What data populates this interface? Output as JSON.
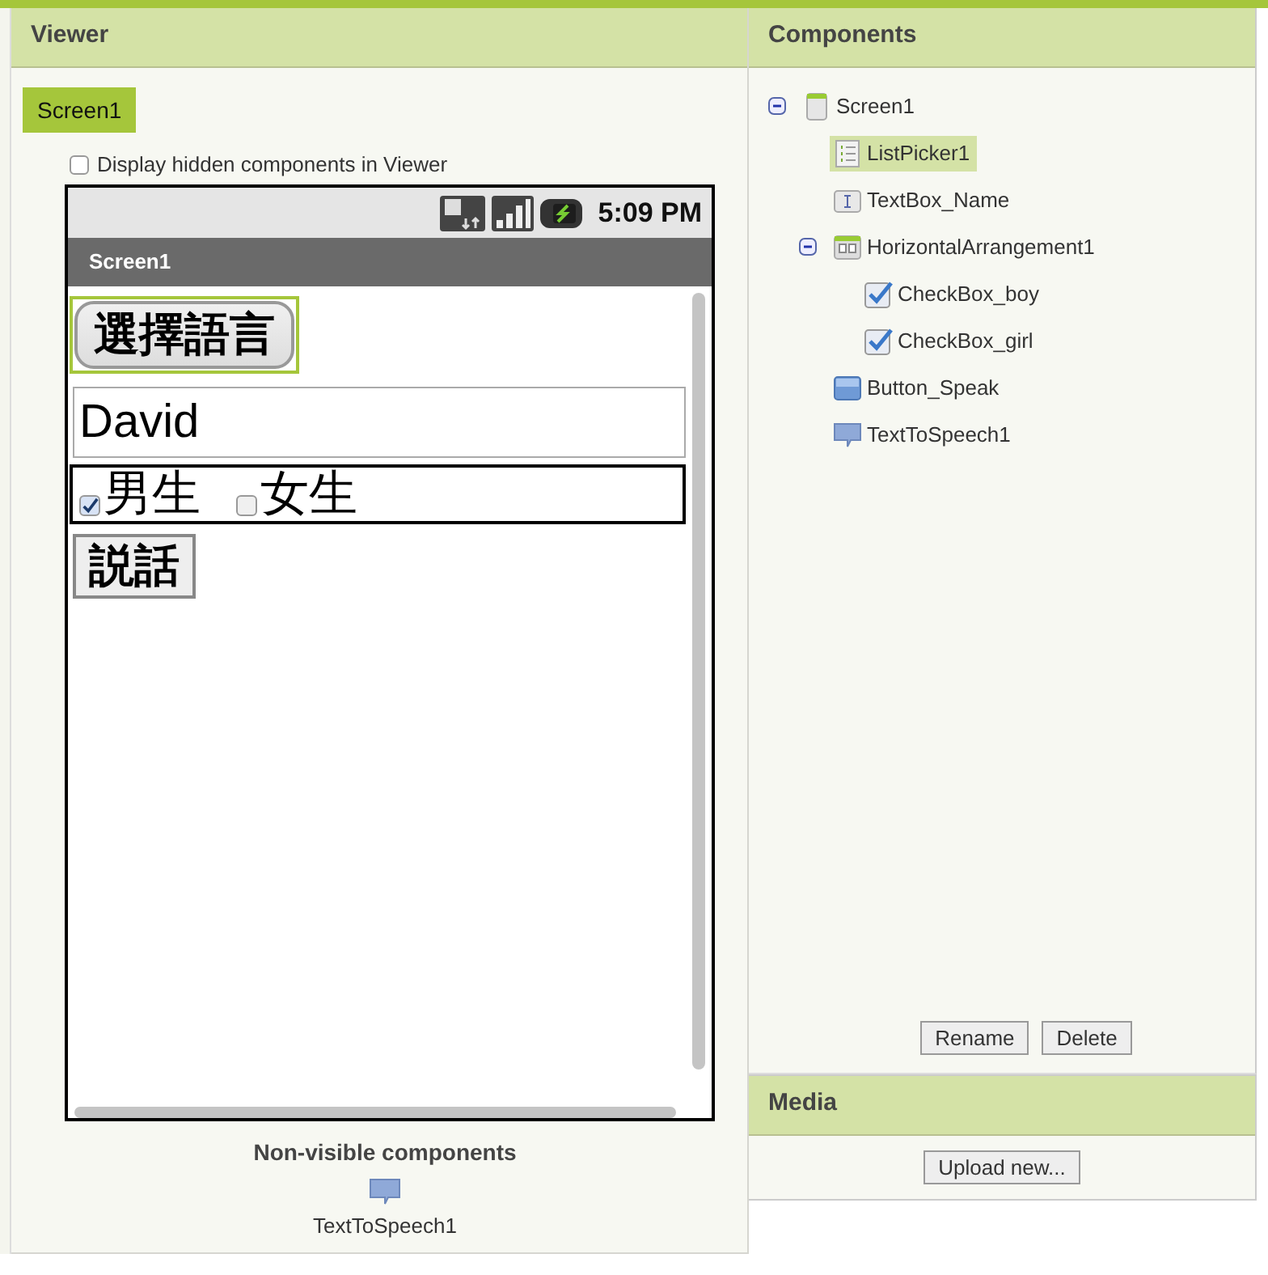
{
  "viewer": {
    "title": "Viewer",
    "screen_tab": "Screen1",
    "hidden_option": {
      "label": "Display hidden components in Viewer",
      "checked": false
    },
    "phone": {
      "time": "5:09 PM",
      "title": "Screen1",
      "list_picker": {
        "label": "選擇語言",
        "selected": true
      },
      "text_box": {
        "value": "David"
      },
      "checkboxes": [
        {
          "label": "男生",
          "checked": true
        },
        {
          "label": "女生",
          "checked": false
        }
      ],
      "button": "説話"
    },
    "non_visible": {
      "title": "Non-visible components",
      "items": [
        {
          "label": "TextToSpeech1"
        }
      ]
    }
  },
  "components": {
    "title": "Components",
    "tree": [
      {
        "label": "Screen1",
        "kind": "screen",
        "expanded": true,
        "selected": false,
        "children": [
          {
            "label": "ListPicker1",
            "kind": "listpicker",
            "selected": true
          },
          {
            "label": "TextBox_Name",
            "kind": "textbox",
            "selected": false
          },
          {
            "label": "HorizontalArrangement1",
            "kind": "arrangement",
            "expanded": true,
            "selected": false,
            "children": [
              {
                "label": "CheckBox_boy",
                "kind": "checkbox",
                "selected": false
              },
              {
                "label": "CheckBox_girl",
                "kind": "checkbox",
                "selected": false
              }
            ]
          },
          {
            "label": "Button_Speak",
            "kind": "button",
            "selected": false
          },
          {
            "label": "TextToSpeech1",
            "kind": "tts",
            "selected": false
          }
        ]
      }
    ],
    "buttons": [
      "Rename",
      "Delete"
    ]
  },
  "media": {
    "title": "Media",
    "button": "Upload new..."
  }
}
